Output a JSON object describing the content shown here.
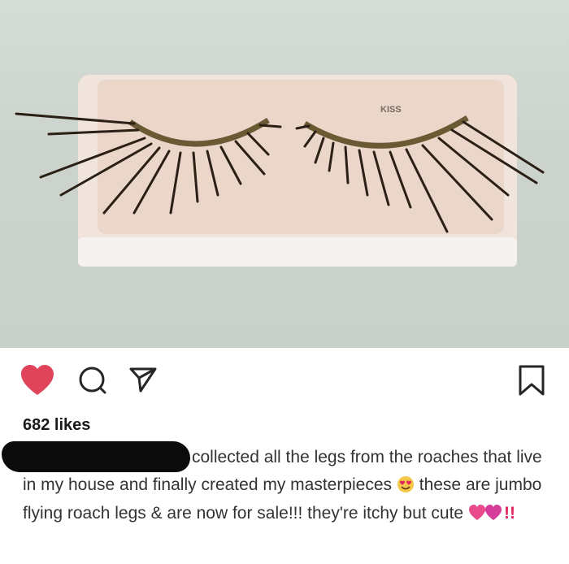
{
  "post": {
    "photo_brand_text": "KISS",
    "likes_text": "682 likes",
    "caption": {
      "part1": "collected all the legs from the roaches that live in my house and finally created my masterpieces",
      "part2": "these are jumbo flying roach legs & are now for sale!!! they're itchy but cute",
      "part3": "!!"
    },
    "icons": {
      "like": "heart-icon",
      "comment": "comment-icon",
      "share": "send-icon",
      "save": "bookmark-icon",
      "emoji1": "smiling-face-with-heart-eyes-icon",
      "emoji2": "two-hearts-icon"
    },
    "colors": {
      "like_active": "#e0445a",
      "text": "#262626"
    }
  }
}
